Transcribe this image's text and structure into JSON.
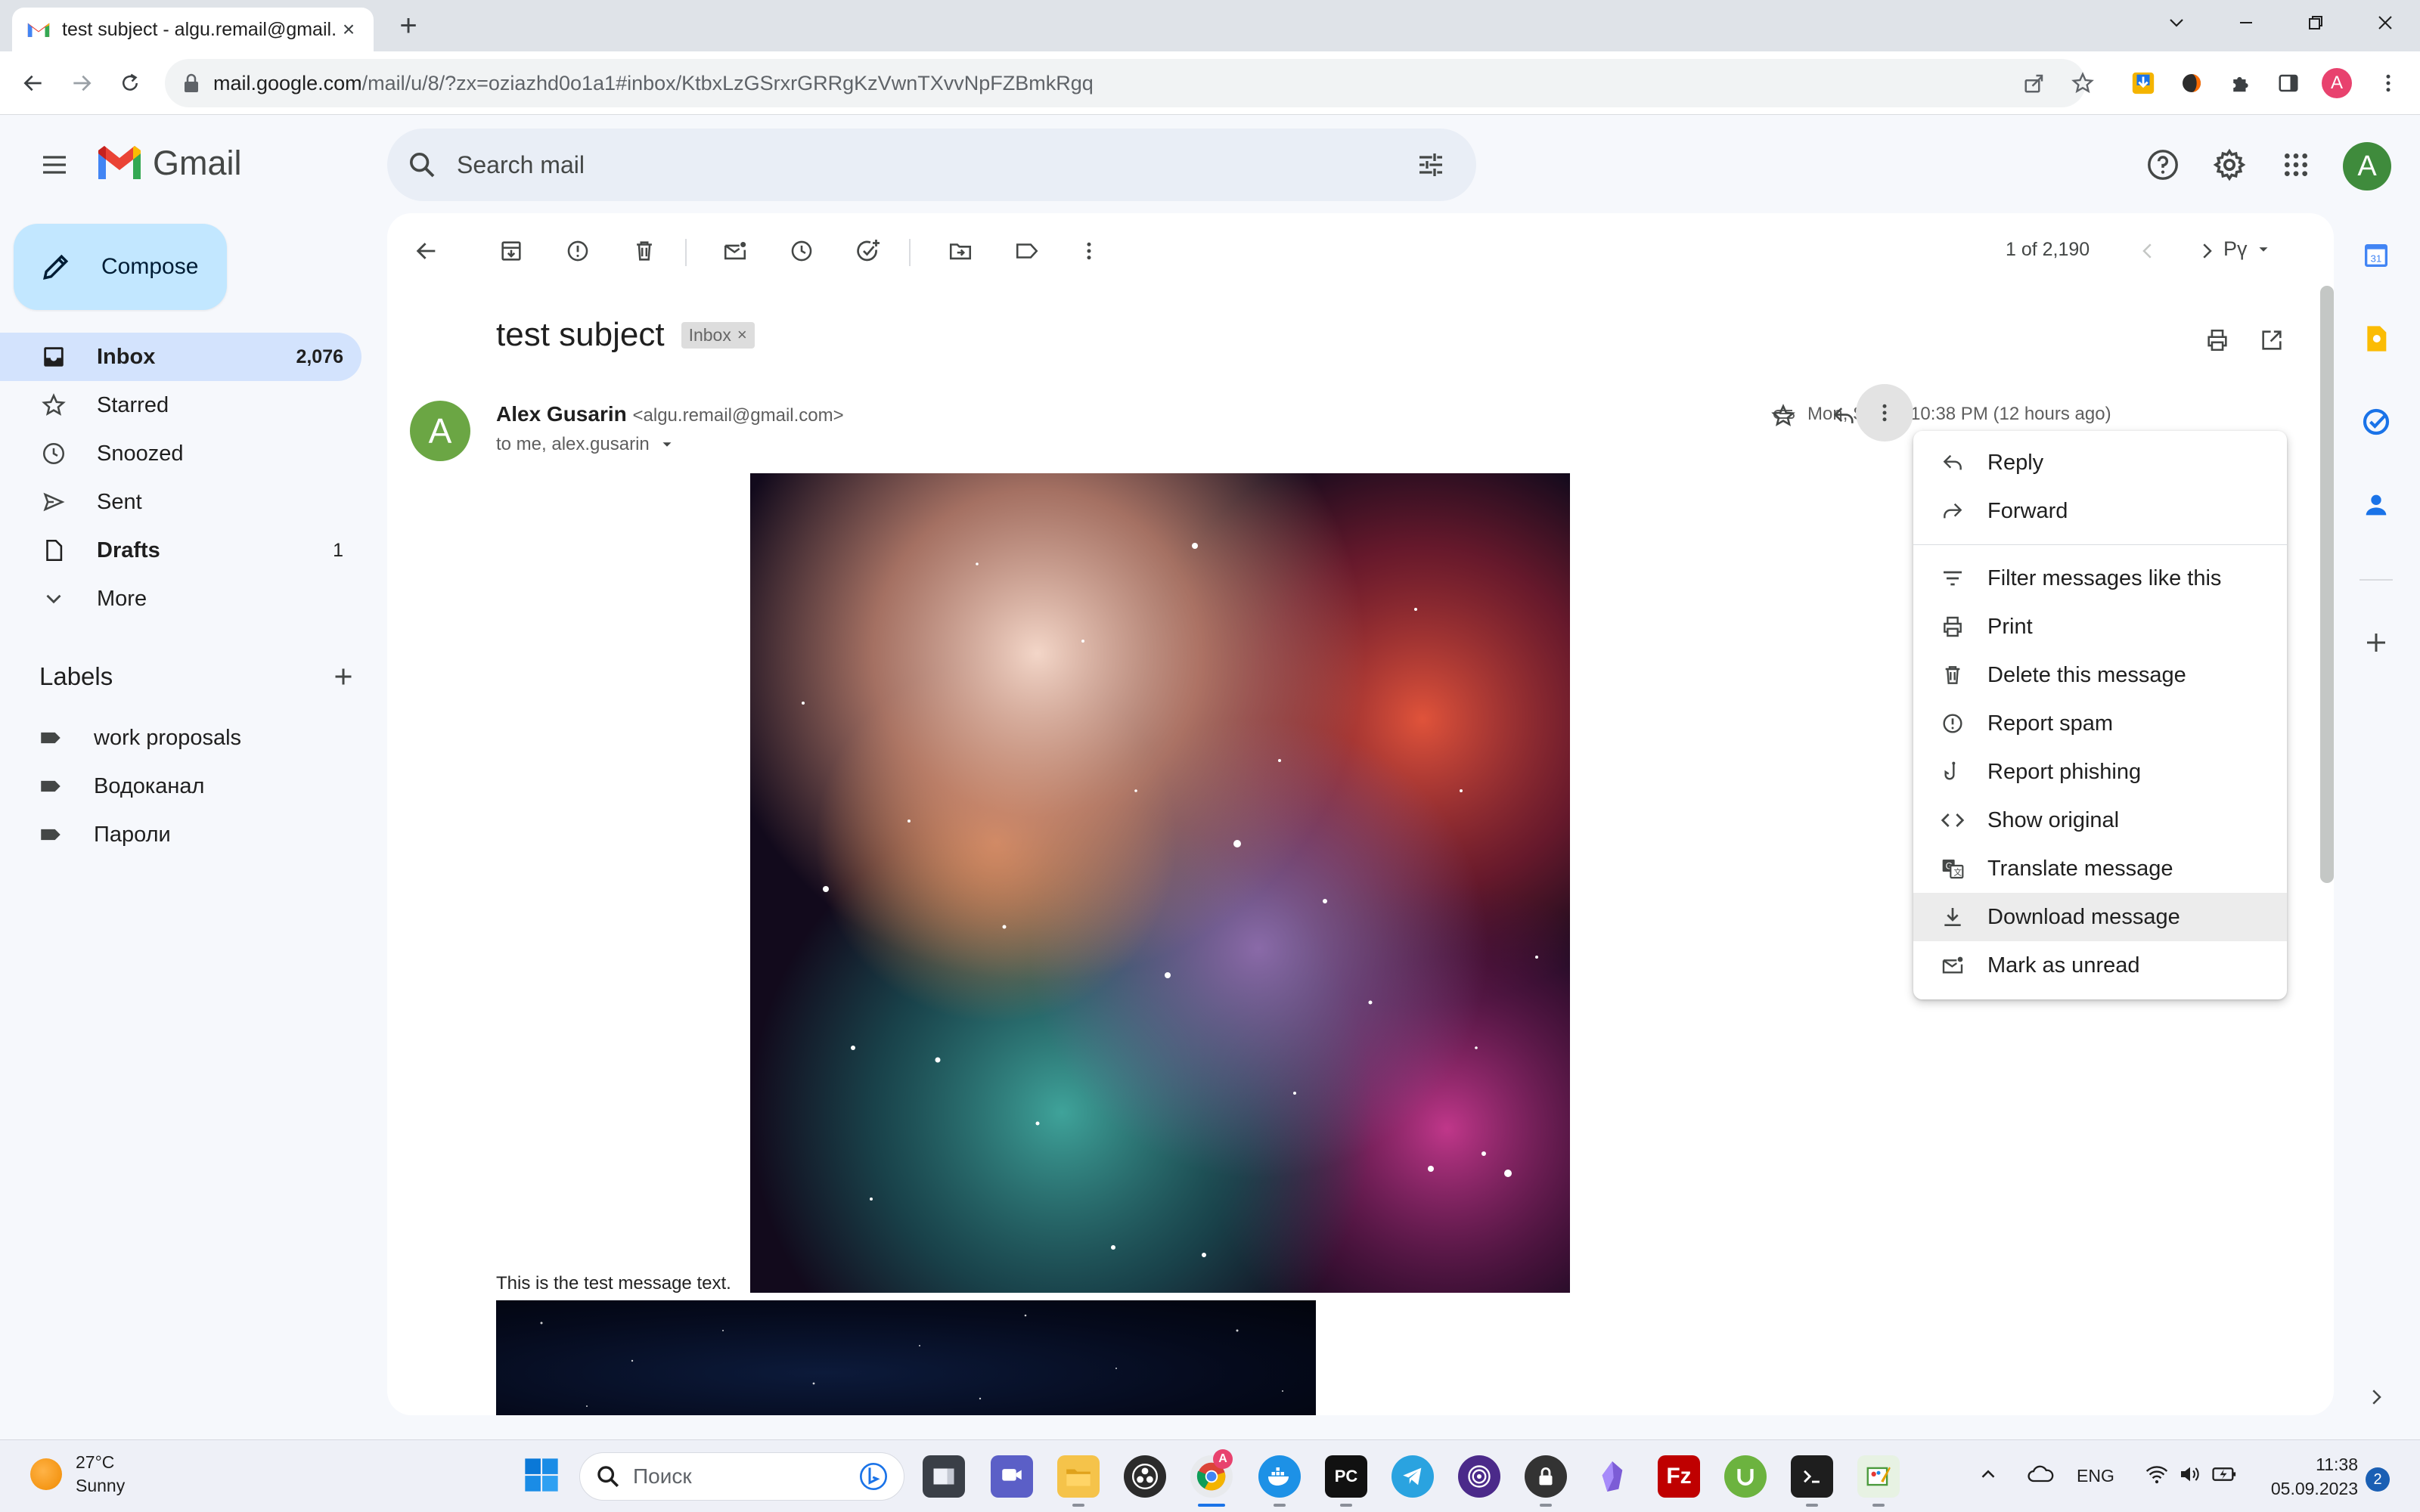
{
  "browser": {
    "tab_title": "test subject - algu.remail@gmail.",
    "url_host": "mail.google.com",
    "url_rest": "/mail/u/8/?zx=oziazhd0o1a1#inbox/KtbxLzGSrxrGRRgKzVwnTXvvNpFZBmkRgq",
    "profile_initial": "A"
  },
  "gmail": {
    "brand": "Gmail",
    "search_placeholder": "Search mail",
    "account_initial": "A",
    "compose_label": "Compose",
    "nav": [
      {
        "label": "Inbox",
        "count": "2,076"
      },
      {
        "label": "Starred",
        "count": ""
      },
      {
        "label": "Snoozed",
        "count": ""
      },
      {
        "label": "Sent",
        "count": ""
      },
      {
        "label": "Drafts",
        "count": "1"
      },
      {
        "label": "More",
        "count": ""
      }
    ],
    "labels_heading": "Labels",
    "labels": [
      "work proposals",
      "Водоканал",
      "Пароли"
    ]
  },
  "message": {
    "pager": "1 of 2,190",
    "lang_toggle": "Рү",
    "subject": "test subject",
    "inbox_chip": "Inbox",
    "chip_close": "×",
    "sender_initial": "A",
    "sender_name": "Alex Gusarin",
    "sender_email": "<algu.remail@gmail.com>",
    "recipients": "to me, alex.gusarin",
    "date": "Mon, Sep 4, 10:38 PM (12 hours ago)",
    "body_text": "This is the test message text."
  },
  "menu": {
    "items": [
      {
        "label": "Reply",
        "icon": "reply-icon"
      },
      {
        "label": "Forward",
        "icon": "forward-icon"
      },
      {
        "label": "Filter messages like this",
        "icon": "filter-icon"
      },
      {
        "label": "Print",
        "icon": "print-icon"
      },
      {
        "label": "Delete this message",
        "icon": "trash-icon"
      },
      {
        "label": "Report spam",
        "icon": "spam-icon"
      },
      {
        "label": "Report phishing",
        "icon": "phishing-hook-icon"
      },
      {
        "label": "Show original",
        "icon": "code-icon"
      },
      {
        "label": "Translate message",
        "icon": "translate-icon"
      },
      {
        "label": "Download message",
        "icon": "download-icon"
      },
      {
        "label": "Mark as unread",
        "icon": "mark-unread-icon"
      }
    ],
    "highlighted": "Download message"
  },
  "taskbar": {
    "temperature": "27°C",
    "condition": "Sunny",
    "search_placeholder": "Поиск",
    "language": "ENG",
    "time": "11:38",
    "date": "05.09.2023",
    "notification_count": "2",
    "chrome_badge": "A"
  },
  "colors": {
    "accent": "#0b57d0",
    "nav_active": "#d3e3fd",
    "compose": "#c2e7ff",
    "avatar_green": "#3f8b3c"
  }
}
